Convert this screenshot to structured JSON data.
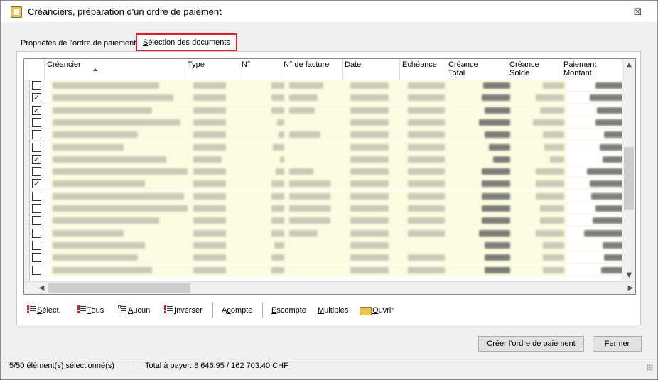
{
  "window": {
    "title": "Créanciers, préparation d'un ordre de paiement",
    "close_glyph": "☒"
  },
  "tabs": [
    {
      "label": "Propriétés de l'ordre de paiement",
      "active": false
    },
    {
      "label_ul": "S",
      "label_rest": "élection des documents",
      "active": true
    }
  ],
  "grid": {
    "columns": [
      {
        "label": "Créancier",
        "sorted": "ascending"
      },
      {
        "label": "Type"
      },
      {
        "label": "N°"
      },
      {
        "label": "N° de facture"
      },
      {
        "label": "Date"
      },
      {
        "label": "Echéance"
      },
      {
        "label": "Créance\nTotal"
      },
      {
        "label": "Créance\nSolde"
      },
      {
        "label": "Paiement\nMontant"
      }
    ],
    "rows": [
      {
        "checked": false
      },
      {
        "checked": true
      },
      {
        "checked": true
      },
      {
        "checked": false
      },
      {
        "checked": false
      },
      {
        "checked": false
      },
      {
        "checked": true
      },
      {
        "checked": false
      },
      {
        "checked": true
      },
      {
        "checked": false
      },
      {
        "checked": false
      },
      {
        "checked": false
      },
      {
        "checked": false
      },
      {
        "checked": false
      },
      {
        "checked": false
      },
      {
        "checked": false
      }
    ],
    "check_glyph": "✓"
  },
  "toolbar": {
    "select": {
      "ul": "S",
      "rest": "élect."
    },
    "all": {
      "ul": "T",
      "rest": "ous"
    },
    "none": {
      "ul": "A",
      "rest": "ucun"
    },
    "invert": {
      "ul": "I",
      "rest": "nverser"
    },
    "deposit": {
      "pre": "A",
      "ul": "c",
      "rest": "ompte"
    },
    "discount": {
      "ul": "E",
      "rest": "scompte"
    },
    "multiple": {
      "ul": "M",
      "rest": "ultiples"
    },
    "open": {
      "ul": "O",
      "rest": "uvrir"
    }
  },
  "buttons": {
    "create": {
      "ul": "C",
      "rest": "réer l'ordre de paiement"
    },
    "close": {
      "ul": "F",
      "rest": "ermer"
    }
  },
  "status": {
    "selection": "5/50 élément(s) sélectionné(s)",
    "total": "Total à payer: 8 646.95 / 162 703.40 CHF"
  }
}
